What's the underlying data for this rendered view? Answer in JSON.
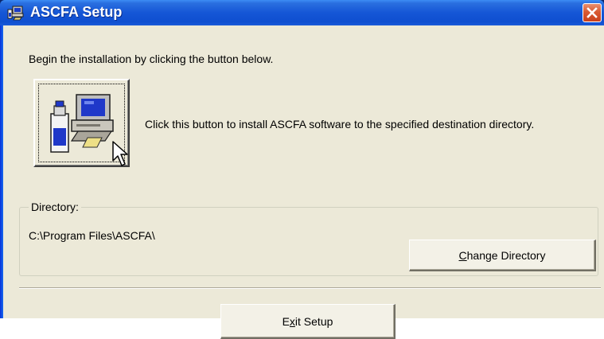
{
  "window": {
    "title": "ASCFA Setup",
    "icons": {
      "title": "setup-computer-icon",
      "close": "close-icon"
    },
    "colors": {
      "titlebar": "#1556d6",
      "close": "#d85a32",
      "face": "#ece9d8"
    }
  },
  "main": {
    "intro_text": "Begin the installation by clicking the button below.",
    "install_button_icon": "computer-install-icon",
    "install_description": "Click this button to install ASCFA software to the specified destination directory."
  },
  "directory": {
    "label": "Directory:",
    "path": "C:\\Program Files\\ASCFA\\",
    "change_button": {
      "mnemonic": "C",
      "rest": "hange Directory"
    }
  },
  "footer": {
    "exit_button": {
      "before": "E",
      "mnemonic": "x",
      "after": "it Setup"
    }
  }
}
